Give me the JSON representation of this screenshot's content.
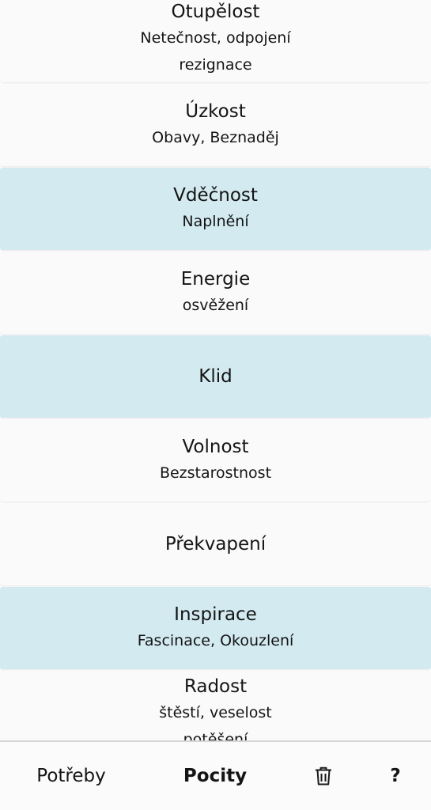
{
  "emotions": [
    {
      "title": "Otupělost",
      "sub1": "Netečnost, odpojení",
      "sub2": "rezignace",
      "highlighted": false
    },
    {
      "title": "Úzkost",
      "sub1": "Obavy, Beznaděj",
      "sub2": "",
      "highlighted": false
    },
    {
      "title": "Vděčnost",
      "sub1": "Naplnění",
      "sub2": "",
      "highlighted": true
    },
    {
      "title": "Energie",
      "sub1": "osvěžení",
      "sub2": "",
      "highlighted": false
    },
    {
      "title": "Klid",
      "sub1": "",
      "sub2": "",
      "highlighted": true
    },
    {
      "title": "Volnost",
      "sub1": "Bezstarostnost",
      "sub2": "",
      "highlighted": false
    },
    {
      "title": "Překvapení",
      "sub1": "",
      "sub2": "",
      "highlighted": false
    },
    {
      "title": "Inspirace",
      "sub1": "Fascinace, Okouzlení",
      "sub2": "",
      "highlighted": true
    },
    {
      "title": "Radost",
      "sub1": "štěstí, veselost",
      "sub2": "potěšení",
      "highlighted": false
    }
  ],
  "bottom_nav": {
    "potreby": "Potřeby",
    "pocity": "Pocity",
    "trash_icon": "trash-icon",
    "help": "?"
  },
  "colors": {
    "highlight": "#d3eaf1",
    "card": "#fafafa"
  }
}
